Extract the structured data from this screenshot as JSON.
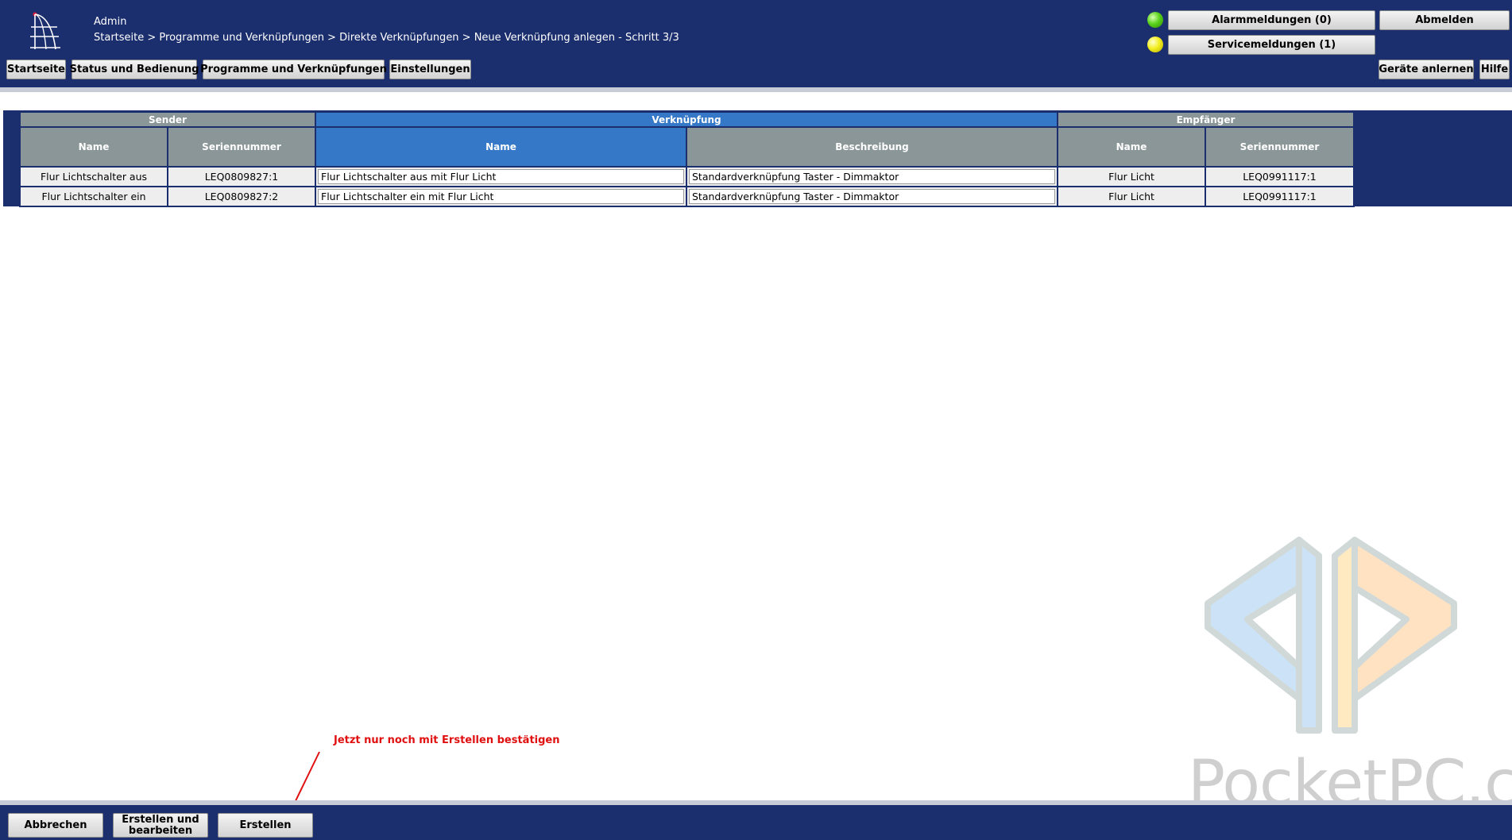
{
  "header": {
    "user": "Admin",
    "breadcrumb": "Startseite > Programme und Verknüpfungen > Direkte Verknüpfungen > Neue Verknüpfung anlegen - Schritt 3/3",
    "alarm_label": "Alarmmeldungen (0)",
    "service_label": "Servicemeldungen (1)",
    "logout_label": "Abmelden",
    "nav": {
      "home": "Startseite",
      "status": "Status und Bedienung",
      "programs": "Programme und Verknüpfungen",
      "settings": "Einstellungen",
      "teach": "Geräte anlernen",
      "help": "Hilfe"
    },
    "colors": {
      "background": "#1b2e6e",
      "alarm_led": "#5ad21c",
      "service_led": "#f3ee20"
    }
  },
  "table": {
    "groups": {
      "sender": "Sender",
      "link": "Verknüpfung",
      "receiver": "Empfänger"
    },
    "columns": {
      "sender_name": "Name",
      "sender_serial": "Seriennummer",
      "link_name": "Name",
      "link_description": "Beschreibung",
      "receiver_name": "Name",
      "receiver_serial": "Seriennummer"
    },
    "rows": [
      {
        "sender_name": "Flur Lichtschalter aus",
        "sender_serial": "LEQ0809827:1",
        "link_name": "Flur Lichtschalter aus mit Flur Licht",
        "link_description": "Standardverknüpfung Taster - Dimmaktor",
        "receiver_name": "Flur Licht",
        "receiver_serial": "LEQ0991117:1"
      },
      {
        "sender_name": "Flur Lichtschalter ein",
        "sender_serial": "LEQ0809827:2",
        "link_name": "Flur Lichtschalter ein mit Flur Licht",
        "link_description": "Standardverknüpfung Taster - Dimmaktor",
        "receiver_name": "Flur Licht",
        "receiver_serial": "LEQ0991117:1"
      }
    ]
  },
  "annotation": {
    "text": "Jetzt nur noch mit Erstellen bestätigen"
  },
  "watermark": {
    "text": "PocketPC.ch"
  },
  "footer": {
    "cancel": "Abbrechen",
    "create_edit": "Erstellen und\nbearbeiten",
    "create": "Erstellen"
  }
}
